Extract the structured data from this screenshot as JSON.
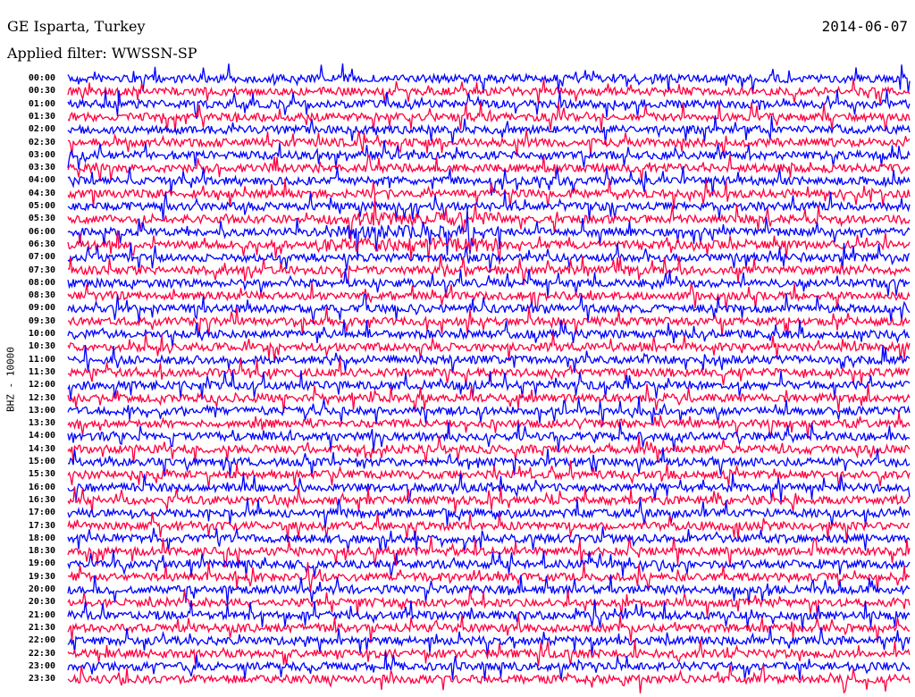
{
  "header": {
    "station": "GE Isparta, Turkey",
    "date": "2014-06-07",
    "filter": "Applied filter: WWSSN-SP"
  },
  "chart_data": {
    "type": "line",
    "title": "GE Isparta, Turkey",
    "subtitle": "Applied filter: WWSSN-SP",
    "date": "2014-06-07",
    "ylabel": "BHZ - 10000",
    "xlabel": "",
    "row_minutes": 30,
    "row_labels": [
      "00:00",
      "00:30",
      "01:00",
      "01:30",
      "02:00",
      "02:30",
      "03:00",
      "03:30",
      "04:00",
      "04:30",
      "05:00",
      "05:30",
      "06:00",
      "06:30",
      "07:00",
      "07:30",
      "08:00",
      "08:30",
      "09:00",
      "09:30",
      "10:00",
      "10:30",
      "11:00",
      "11:30",
      "12:00",
      "12:30",
      "13:00",
      "13:30",
      "14:00",
      "14:30",
      "15:00",
      "15:30",
      "16:00",
      "16:30",
      "17:00",
      "17:30",
      "18:00",
      "18:30",
      "19:00",
      "19:30",
      "20:00",
      "20:30",
      "21:00",
      "21:30",
      "22:00",
      "22:30",
      "23:00",
      "23:30"
    ],
    "series_colors": [
      "#0000ff",
      "#ff0040"
    ],
    "event_window": {
      "row_labels": [
        "05:30",
        "06:00",
        "06:30"
      ],
      "note": "higher-amplitude signal"
    }
  }
}
